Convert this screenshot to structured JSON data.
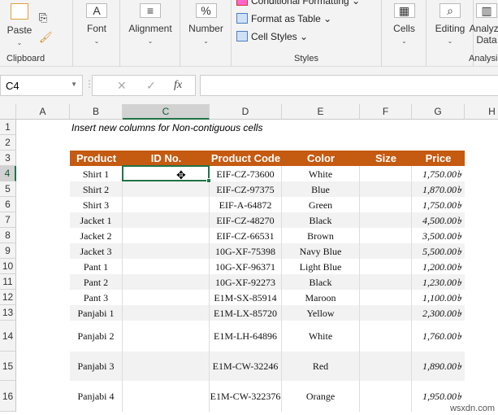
{
  "ribbon": {
    "clipboard": {
      "paste": "Paste",
      "label": "Clipboard"
    },
    "font": "Font",
    "alignment": "Alignment",
    "number": "Number",
    "styles": {
      "conditional": "Conditional Formatting",
      "format_table": "Format as Table",
      "cell_styles": "Cell Styles",
      "label": "Styles"
    },
    "cells": "Cells",
    "editing": "Editing",
    "analyze": "Analyze Data",
    "analysis": "Analysis"
  },
  "formula_bar": {
    "name_box": "C4",
    "cancel": "✕",
    "enter": "✓",
    "fx": "fx",
    "value": ""
  },
  "columns": [
    "A",
    "B",
    "C",
    "D",
    "E",
    "F",
    "G",
    "H"
  ],
  "selected_cell": "C4",
  "note": "Insert new columns for Non-contiguous cells",
  "table": {
    "headers": [
      "Product",
      "ID No.",
      "Product Code",
      "Color",
      "Size",
      "Price"
    ],
    "rows": [
      {
        "row": "4",
        "product": "Shirt 1",
        "code": "EIF-CZ-73600",
        "color": "White",
        "price": "1,750.00৳"
      },
      {
        "row": "5",
        "product": "Shirt 2",
        "code": "EIF-CZ-97375",
        "color": "Blue",
        "price": "1,870.00৳"
      },
      {
        "row": "6",
        "product": "Shirt 3",
        "code": "EIF-A-64872",
        "color": "Green",
        "price": "1,750.00৳"
      },
      {
        "row": "7",
        "product": "Jacket 1",
        "code": "EIF-CZ-48270",
        "color": "Black",
        "price": "4,500.00৳"
      },
      {
        "row": "8",
        "product": "Jacket 2",
        "code": "EIF-CZ-66531",
        "color": "Brown",
        "price": "3,500.00৳"
      },
      {
        "row": "9",
        "product": "Jacket 3",
        "code": "10G-XF-75398",
        "color": "Navy Blue",
        "price": "5,500.00৳"
      },
      {
        "row": "10",
        "product": "Pant 1",
        "code": "10G-XF-96371",
        "color": "Light Blue",
        "price": "1,200.00৳"
      },
      {
        "row": "11",
        "product": "Pant 2",
        "code": "10G-XF-92273",
        "color": "Black",
        "price": "1,230.00৳"
      },
      {
        "row": "12",
        "product": "Pant 3",
        "code": "E1M-SX-85914",
        "color": "Maroon",
        "price": "1,100.00৳"
      },
      {
        "row": "13",
        "product": "Panjabi 1",
        "code": "E1M-LX-85720",
        "color": "Yellow",
        "price": "2,300.00৳"
      },
      {
        "row": "14",
        "product": "Panjabi 2",
        "code": "E1M-LH-64896",
        "color": "White",
        "price": "1,760.00৳"
      },
      {
        "row": "15",
        "product": "Panjabi 3",
        "code": "E1M-CW-32246",
        "color": "Red",
        "price": "1,890.00৳"
      },
      {
        "row": "16",
        "product": "Panjabi 4",
        "code": "E1M-CW-322376",
        "color": "Orange",
        "price": "1,950.00৳"
      }
    ]
  },
  "row_numbers": [
    "1",
    "2",
    "3"
  ],
  "colors": {
    "header": "#c55a11",
    "stripe": "#f2f2f2",
    "selection": "#217346"
  },
  "watermark": "wsxdn.com"
}
